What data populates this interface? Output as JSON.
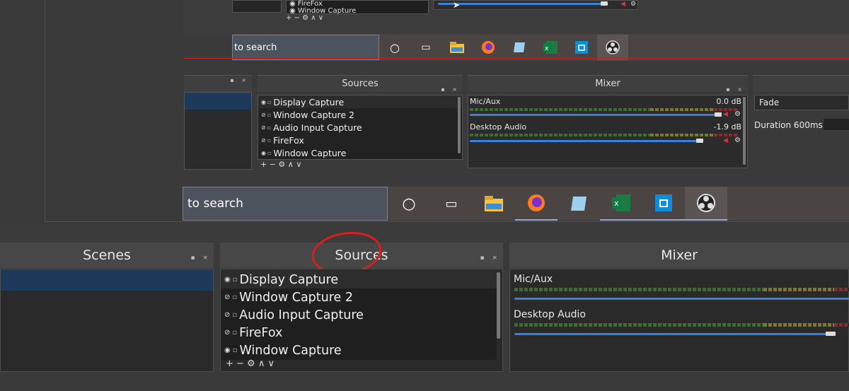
{
  "top_layer": {
    "sources": [
      "FireFox",
      "Window Capture"
    ],
    "toolbar": "+ − ⚙ ∧ ∨"
  },
  "taskbar_small": {
    "search_text": "to search",
    "icons": [
      "cortana-circle",
      "task-view",
      "file-explorer",
      "firefox",
      "notepad",
      "excel",
      "store",
      "obs"
    ]
  },
  "middle_obs": {
    "sources_title": "Sources",
    "mixer_title": "Mixer",
    "sources": [
      "Display Capture",
      "Window Capture 2",
      "Audio Input Capture",
      "FireFox",
      "Window Capture"
    ],
    "toolbar": "+ − ⚙  ∧ ∨",
    "mixer": [
      {
        "name": "Mic/Aux",
        "db": "0.0 dB"
      },
      {
        "name": "Desktop Audio",
        "db": "-1.9 dB"
      }
    ],
    "transition": {
      "name": "Fade",
      "duration": "Duration 600ms"
    }
  },
  "taskbar_large": {
    "search_text": "to search"
  },
  "bottom_obs": {
    "scenes_title": "Scenes",
    "sources_title": "Sources",
    "mixer_title": "Mixer",
    "sources": [
      "Display Capture",
      "Window Capture 2",
      "Audio Input Capture",
      "FireFox",
      "Window Capture"
    ],
    "toolbar": "+ − ⚙   ∧ ∨",
    "mixer": [
      {
        "name": "Mic/Aux"
      },
      {
        "name": "Desktop Audio"
      }
    ]
  },
  "colors": {
    "accent_blue": "#3a80d8",
    "annotation_red": "#d81e1e",
    "selected_scene": "#1d3a5c"
  }
}
